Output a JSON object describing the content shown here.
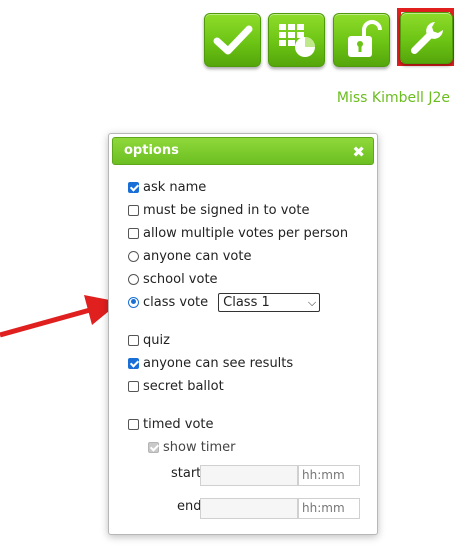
{
  "toolbar": {
    "tiles": [
      {
        "icon": "checkmark-icon"
      },
      {
        "icon": "results-chart-icon"
      },
      {
        "icon": "unlock-icon"
      },
      {
        "icon": "wrench-icon",
        "selected": true
      }
    ],
    "accent": "#6cc414",
    "selected_border": "#e01f1f"
  },
  "teacher_label": "Miss Kimbell J2e",
  "dialog": {
    "title": "options",
    "close_glyph": "✖",
    "options": {
      "ask_name": {
        "label": "ask name",
        "checked": true
      },
      "signed_in": {
        "label": "must be signed in to vote",
        "checked": false
      },
      "multiple_votes": {
        "label": "allow multiple votes per person",
        "checked": false
      },
      "anyone_vote": {
        "label": "anyone can vote",
        "selected": false
      },
      "school_vote": {
        "label": "school vote",
        "selected": false
      },
      "class_vote": {
        "label": "class vote",
        "selected": true,
        "class_select": "Class 1"
      },
      "quiz": {
        "label": "quiz",
        "checked": false
      },
      "see_results": {
        "label": "anyone can see results",
        "checked": true
      },
      "secret_ballot": {
        "label": "secret ballot",
        "checked": false
      },
      "timed_vote": {
        "label": "timed vote",
        "checked": false
      },
      "show_timer": {
        "label": "show timer",
        "checked": true,
        "disabled": true
      }
    },
    "timer": {
      "start_label": "start",
      "end_label": "end",
      "start_unit": "hh:mm",
      "end_unit": "hh:mm"
    }
  },
  "annotation": {
    "arrow_color": "#e01f1f"
  }
}
